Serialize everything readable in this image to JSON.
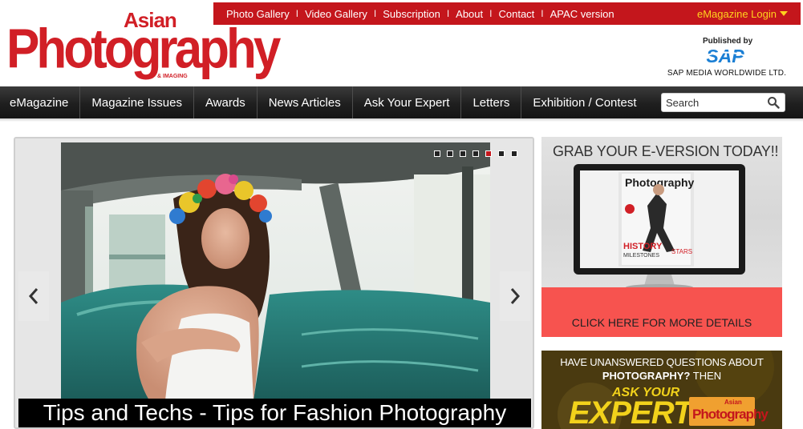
{
  "logo": {
    "asian": "Asian",
    "photography": "Photography",
    "imaging": "& IMAGING"
  },
  "topnav": {
    "links": [
      "Photo Gallery",
      "Video Gallery",
      "Subscription",
      "About",
      "Contact",
      "APAC version"
    ],
    "separator": "I",
    "emagazine_login": "eMagazine Login"
  },
  "publisher": {
    "published_by": "Published by",
    "brand": "SAP",
    "company": "SAP MEDIA WORLDWIDE LTD."
  },
  "mainnav": {
    "items": [
      "eMagazine",
      "Magazine Issues",
      "Awards",
      "News Articles",
      "Ask Your Expert",
      "Letters",
      "Exhibition / Contest"
    ]
  },
  "search": {
    "placeholder": "Search"
  },
  "slider": {
    "caption": "Tips and Techs - Tips for Fashion Photography",
    "dots_count": 7,
    "active_dot": 4
  },
  "eversion": {
    "title": "GRAB YOUR E-VERSION TODAY!!",
    "cta": "CLICK HERE FOR MORE DETAILS",
    "cover_title": "Photography",
    "cover_headline": "HISTORY",
    "cover_sub": "MILESTONES",
    "cover_stars": "STARS"
  },
  "ask_expert": {
    "line1": "HAVE UNANSWERED QUESTIONS ABOUT",
    "line2_bold": "PHOTOGRAPHY?",
    "line2_rest": " THEN",
    "ask_your": "ASK YOUR",
    "expert": "EXPERT",
    "mini_asian": "Asian",
    "mini_photography": "Photography"
  },
  "colors": {
    "brand_red": "#c4161c",
    "accent_yellow": "#ffd21e",
    "cta_salmon": "#f7534f",
    "nav_dark": "#1f1f1f"
  }
}
